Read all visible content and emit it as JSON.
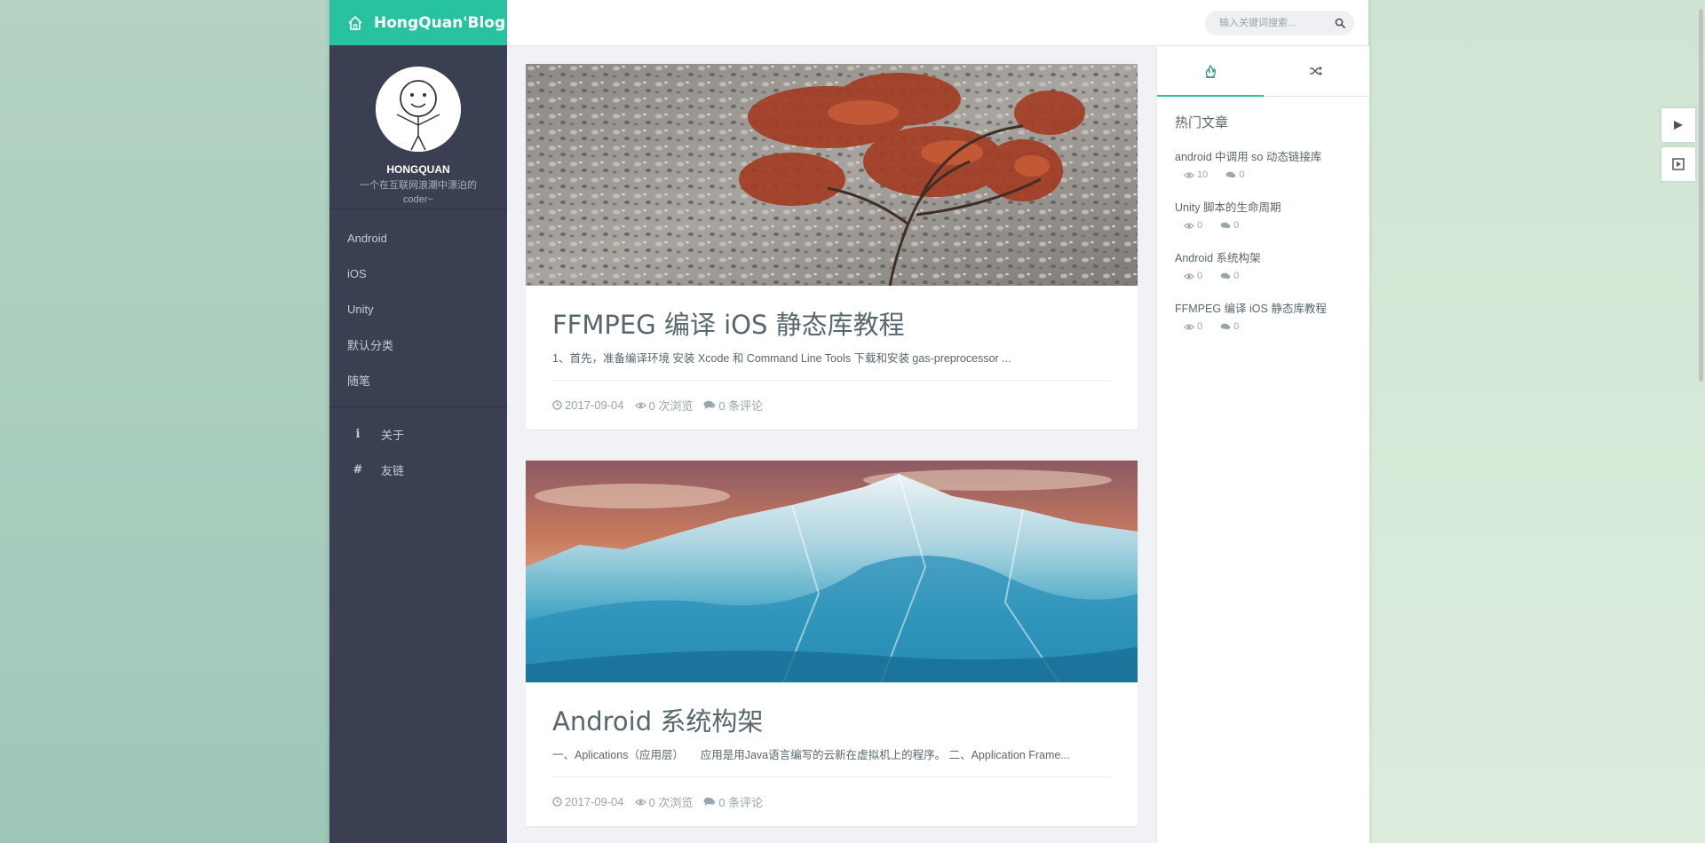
{
  "brand": {
    "title": "HongQuan'Blog"
  },
  "profile": {
    "name": "HONGQUAN",
    "bio": "一个在互联网浪潮中漂泊的coder~"
  },
  "nav": {
    "categories": [
      {
        "label": "Android"
      },
      {
        "label": "iOS"
      },
      {
        "label": "Unity"
      },
      {
        "label": "默认分类"
      },
      {
        "label": "随笔"
      }
    ],
    "pages": [
      {
        "label": "关于",
        "icon": "info-icon"
      },
      {
        "label": "友链",
        "icon": "hash-icon"
      }
    ]
  },
  "search": {
    "placeholder": "输入关键词搜索..."
  },
  "posts": [
    {
      "title": "FFMPEG 编译 iOS 静态库教程",
      "excerpt": "1、首先，准备编译环境 安装 Xcode 和 Command Line Tools 下载和安装 gas-preprocessor ...",
      "date": "2017-09-04",
      "views": "0 次浏览",
      "comments": "0 条评论"
    },
    {
      "title": "Android 系统构架",
      "excerpt": "一、Aplications（应用层）　　应用是用Java语言编写的云新在虚拟机上的程序。 二、Application Frame...",
      "date": "2017-09-04",
      "views": "0 次浏览",
      "comments": "0 条评论"
    }
  ],
  "aside": {
    "heading": "热门文章",
    "hot": [
      {
        "title": "android 中调用 so 动态链接库",
        "views": "10",
        "comments": "0"
      },
      {
        "title": "Unity 脚本的生命周期",
        "views": "0",
        "comments": "0"
      },
      {
        "title": "Android 系统构架",
        "views": "0",
        "comments": "0"
      },
      {
        "title": "FFMPEG 编译 iOS 静态库教程",
        "views": "0",
        "comments": "0"
      }
    ]
  },
  "colors": {
    "accent": "#27c3a0",
    "sidebar": "#3a3f51",
    "text": "#58666e",
    "muted": "#98a6ad"
  }
}
